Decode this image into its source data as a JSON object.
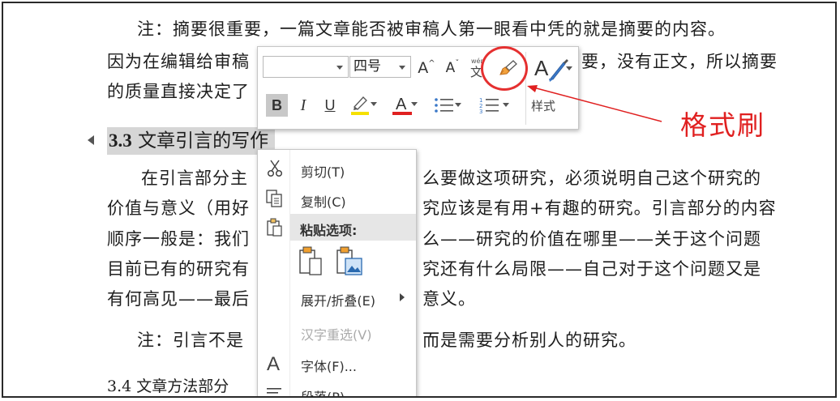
{
  "document": {
    "para1_line1": "注：摘要很重要，一篇文章能否被审稿人第一眼看中凭的就是摘要的内容。",
    "para1_line2a": "因为在编辑给审稿",
    "para1_line2b": "要，没有正文，所以摘要",
    "para1_line3": "的质量直接决定了",
    "heading_num": "3.3",
    "heading_text": "文章引言的写作",
    "para2_line1a": "在引言部分主",
    "para2_line1b": "么要做这项研究，必须说明自己这个研究的",
    "para2_line2a": "价值与意义（用好",
    "para2_line2b": "究应该是有用+有趣的研究。引言部分的内容",
    "para2_line3a": "顺序一般是：我们",
    "para2_line3b": "么——研究的价值在哪里——关于这个问题",
    "para2_line4a": "目前已有的研究有",
    "para2_line4b": "究还有什么局限——自己对于这个问题又是",
    "para2_line5a": "有何高见——最后",
    "para2_line5b": "意义。",
    "para3a": "注：引言不是",
    "para3b": "而是需要分析别人的研究。",
    "heading2": "3.4 文章方法部分"
  },
  "minibar": {
    "font_value": "",
    "size_value": "四号",
    "grow_label": "A",
    "shrink_label": "A",
    "bold_label": "B",
    "italic_label": "I",
    "underline_label": "U",
    "font_color_label": "A",
    "styles_label": "样式",
    "highlight_color": "#f5e000",
    "font_color": "#e02020"
  },
  "annotation": {
    "label": "格式刷",
    "color": "#e02020"
  },
  "context_menu": {
    "cut": "剪切(T)",
    "copy": "复制(C)",
    "paste_header": "粘贴选项:",
    "expand": "展开/折叠(E)",
    "reconvert": "汉字重选(V)",
    "font": "字体(F)...",
    "paragraph": "段落(P)..."
  }
}
